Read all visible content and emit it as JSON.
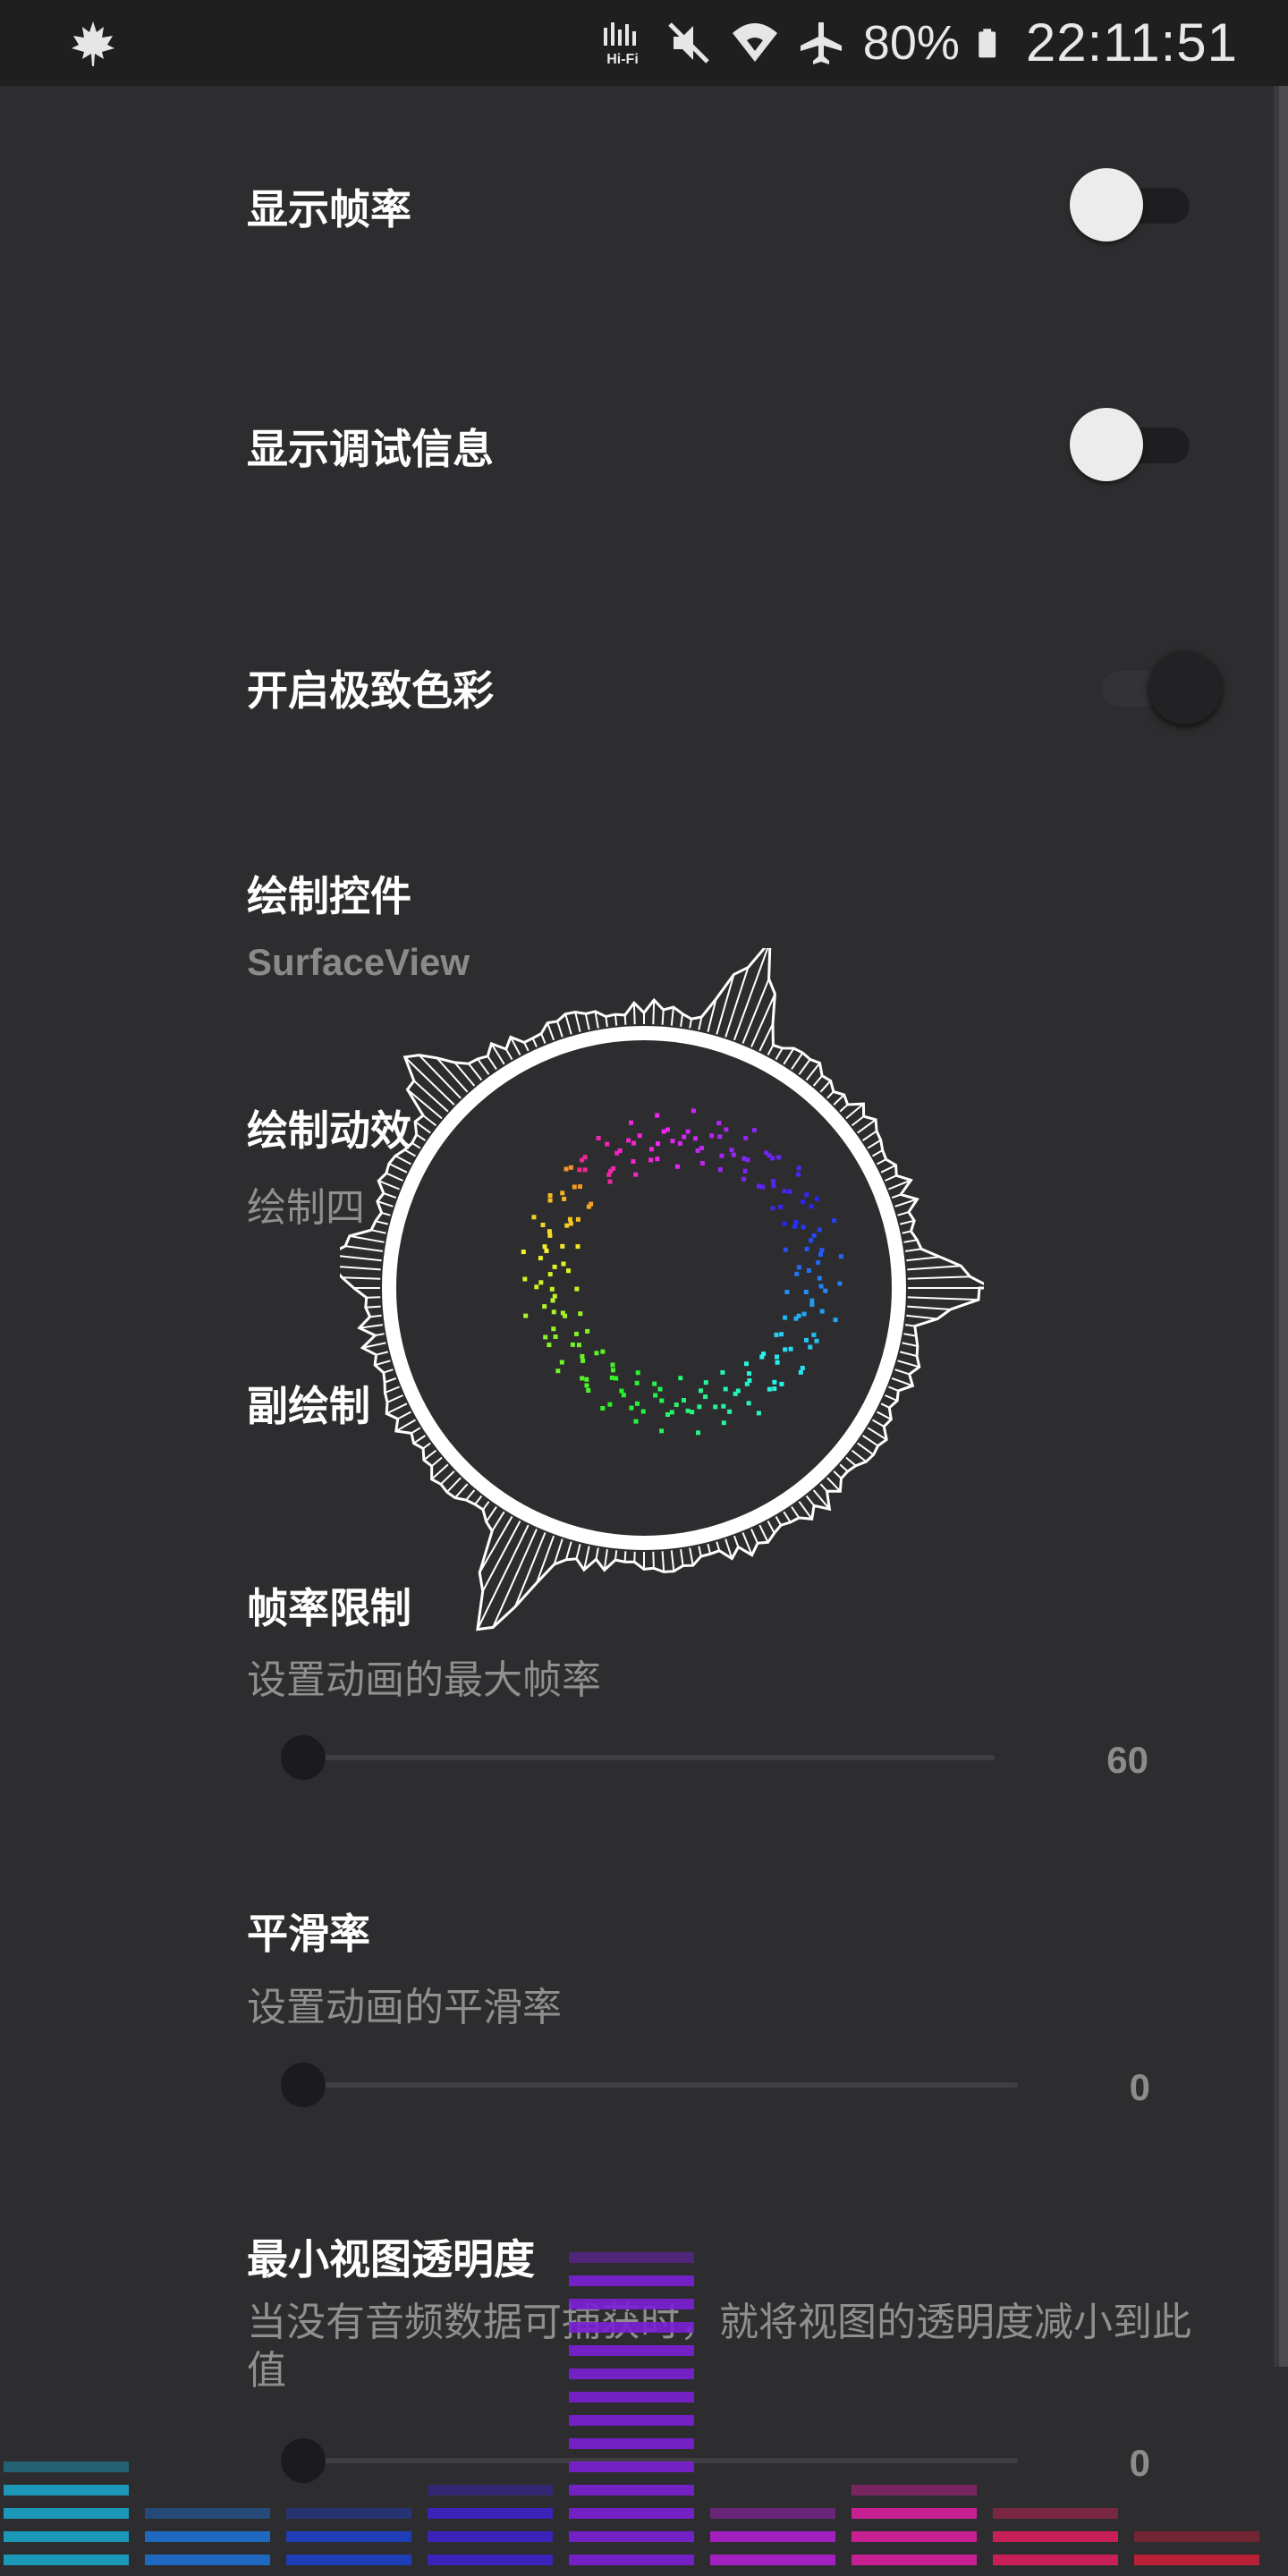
{
  "status_bar": {
    "app_icon": "maple-leaf-icon",
    "hifi_label": "Hi-Fi",
    "battery_percent": "80%",
    "time": "22:11:51",
    "icons": [
      "hifi-icon",
      "mute-icon",
      "wifi-icon",
      "airplane-mode-icon",
      "battery-icon"
    ]
  },
  "settings": {
    "show_fps": {
      "title": "显示帧率",
      "enabled": false
    },
    "show_debug": {
      "title": "显示调试信息",
      "enabled": false
    },
    "extreme_color": {
      "title": "开启极致色彩",
      "enabled": true
    },
    "draw_widget": {
      "title": "绘制控件",
      "value": "SurfaceView"
    },
    "draw_effect": {
      "title": "绘制动效",
      "value": "绘制四"
    },
    "secondary_draw": {
      "title": "副绘制"
    },
    "fps_limit": {
      "title": "帧率限制",
      "description": "设置动画的最大帧率",
      "value": "60",
      "fraction": 0
    },
    "smoothing": {
      "title": "平滑率",
      "description": "设置动画的平滑率",
      "value": "0",
      "fraction": 0
    },
    "min_opacity": {
      "title": "最小视图透明度",
      "description": "当没有音频数据可捕获时，就将视图的透明度减小到此值",
      "value": "0",
      "fraction": 0
    }
  },
  "colors": {
    "background": "#2d2d2f",
    "status_bar": "#1f1f1f",
    "switch_off_thumb": "#ececec",
    "spectrum": [
      "#1aa3c8",
      "#1d6fd0",
      "#1f3fc8",
      "#3b22c8",
      "#7b1fd6",
      "#b01fd0",
      "#d81f9e",
      "#d81f5c",
      "#c81f3a"
    ]
  }
}
